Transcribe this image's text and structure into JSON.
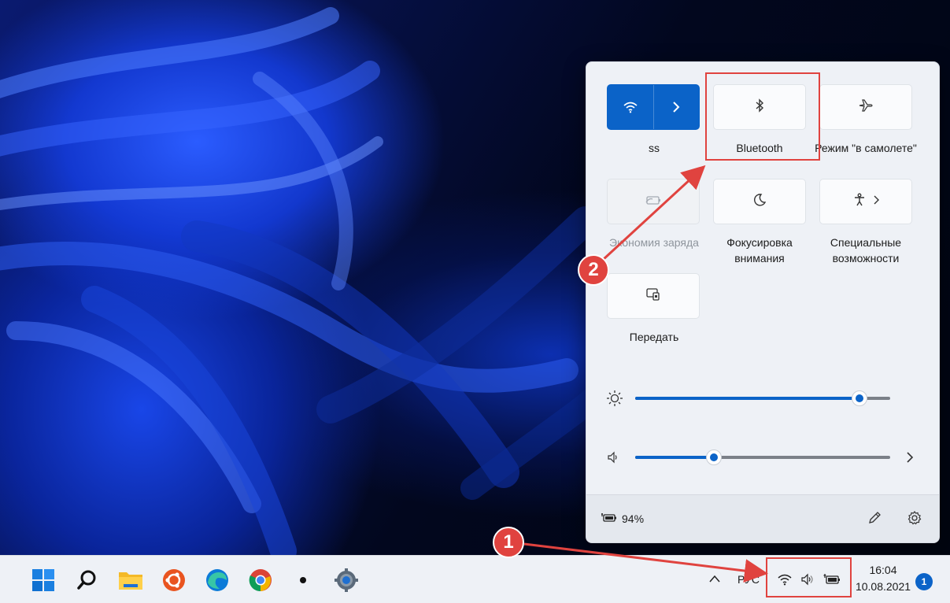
{
  "quick_settings": {
    "tiles": [
      {
        "label": "ss",
        "icon": "wifi-icon",
        "state": "on"
      },
      {
        "label": "Bluetooth",
        "icon": "bluetooth-icon",
        "state": "off"
      },
      {
        "label": "Режим \"в самолете\"",
        "icon": "airplane-icon",
        "state": "off"
      },
      {
        "label": "Экономия заряда",
        "icon": "battery-saver-icon",
        "state": "disabled"
      },
      {
        "label": "Фокусировка внимания",
        "icon": "moon-icon",
        "state": "off"
      },
      {
        "label": "Специальные возможности",
        "icon": "accessibility-icon",
        "state": "off"
      },
      {
        "label": "Передать",
        "icon": "cast-icon",
        "state": "off"
      }
    ],
    "brightness": {
      "icon": "sun-icon",
      "level": 0.88
    },
    "volume": {
      "icon": "speaker-icon",
      "level": 0.31
    },
    "battery_text": "94%"
  },
  "taskbar": {
    "apps": [
      "windows-start-icon",
      "search-icon",
      "file-explorer-icon",
      "ubuntu-icon",
      "edge-icon",
      "chrome-icon",
      "dot-icon",
      "settings-icon"
    ],
    "language": "РУС",
    "time": "16:04",
    "date": "10.08.2021",
    "notification_count": "1"
  },
  "annotations": {
    "marker1": "1",
    "marker2": "2"
  },
  "colors": {
    "accent": "#0b63c8",
    "annotation": "#e0433f"
  }
}
